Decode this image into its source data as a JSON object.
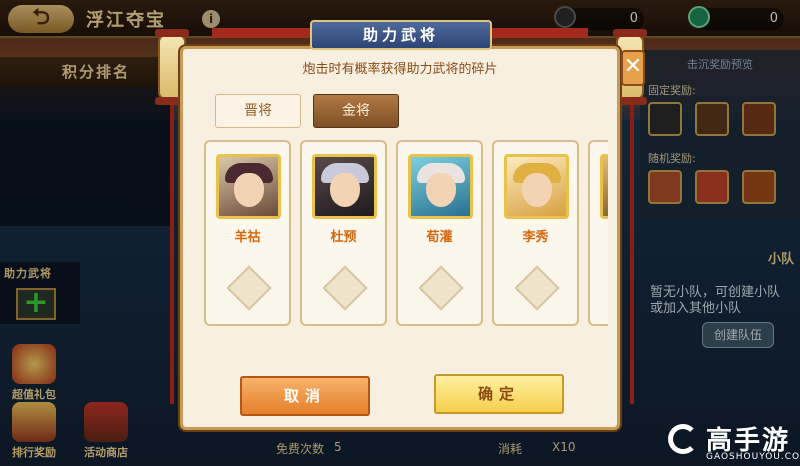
{
  "topbar": {
    "back_label": "⮌",
    "map_title": "浮江夺宝",
    "res1_value": "0",
    "res2_value": "0"
  },
  "left_panel": {
    "header": "积分排名"
  },
  "assist_panel": {
    "title": "助力武将",
    "plus": "+"
  },
  "side_icons": [
    {
      "label": "超值礼包"
    },
    {
      "label": "排行奖励"
    },
    {
      "label": "活动商店"
    }
  ],
  "right_panel": {
    "title": "击沉奖励预览",
    "fixed_label": "固定奖励:",
    "random_label": "随机奖励:"
  },
  "team_panel": {
    "title": "小队",
    "desc_line1": "暂无小队，可创建小队",
    "desc_line2": "或加入其他小队",
    "create_label": "创建队伍"
  },
  "bottom_bar": {
    "free_label": "免费次数",
    "free_count": "5",
    "cost_label": "消耗",
    "cost_count": "X10"
  },
  "dialog": {
    "title": "助力武将",
    "subtitle": "炮击时有概率获得助力武将的碎片",
    "close": "✕",
    "tabs": [
      {
        "label": "晋将",
        "active": false
      },
      {
        "label": "金将",
        "active": true
      }
    ],
    "heroes": [
      {
        "name": "羊祜",
        "hair": "#4a2a30"
      },
      {
        "name": "杜预",
        "hair": "#c9c9d9"
      },
      {
        "name": "荀灌",
        "hair": "#e9e4e0"
      },
      {
        "name": "李秀",
        "hair": "#e0b040"
      }
    ],
    "cancel_label": "取消",
    "confirm_label": "确定"
  },
  "watermark": {
    "brand": "高手游",
    "url": "GAOSHOUYOU.COM"
  },
  "colors": {
    "accent_orange": "#e57f2a",
    "accent_gold": "#f5cf4a",
    "hero_name": "#d6680f",
    "banner_blue": "#2d4574"
  }
}
